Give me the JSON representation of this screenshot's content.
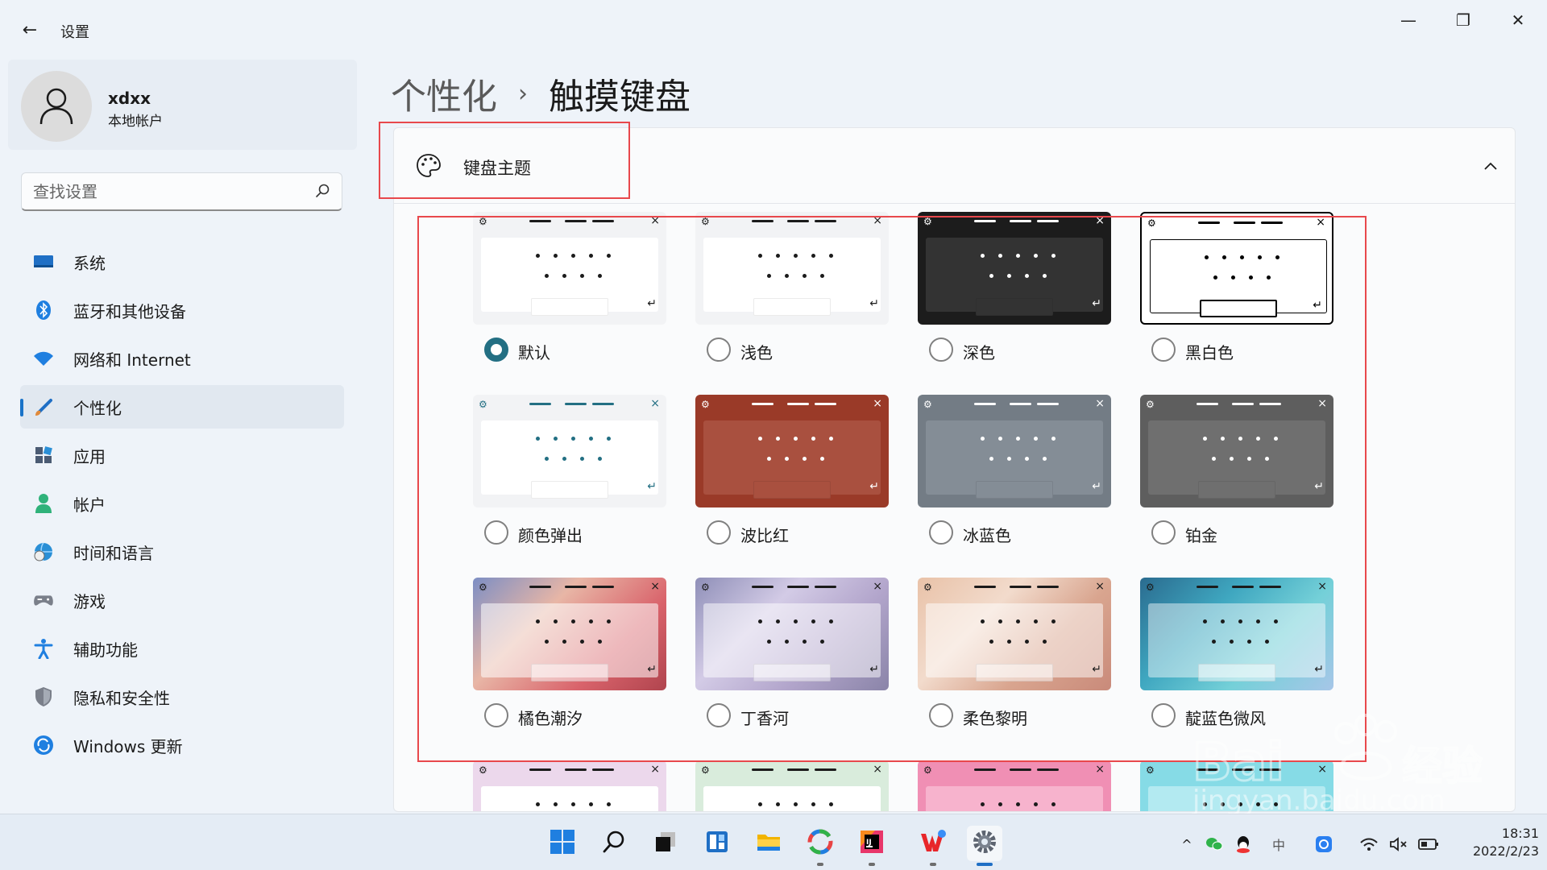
{
  "window": {
    "title": "设置",
    "back_glyph": "←",
    "min_glyph": "—",
    "max_glyph": "❐",
    "close_glyph": "✕"
  },
  "user": {
    "name": "xdxx",
    "account_type": "本地帐户"
  },
  "search": {
    "placeholder": "查找设置"
  },
  "nav": [
    {
      "label": "系统",
      "icon": "system-icon",
      "color": "#1f6fc5"
    },
    {
      "label": "蓝牙和其他设备",
      "icon": "bluetooth-icon",
      "color": "#1f7fe0"
    },
    {
      "label": "网络和 Internet",
      "icon": "wifi-icon",
      "color": "#1f7fe0"
    },
    {
      "label": "个性化",
      "icon": "brush-icon",
      "color": "#e08a3c",
      "active": true
    },
    {
      "label": "应用",
      "icon": "apps-icon",
      "color": "#4b5b73"
    },
    {
      "label": "帐户",
      "icon": "account-icon",
      "color": "#2fb27a"
    },
    {
      "label": "时间和语言",
      "icon": "globe-clock-icon",
      "color": "#2a8fd6"
    },
    {
      "label": "游戏",
      "icon": "gamepad-icon",
      "color": "#7a7f8a"
    },
    {
      "label": "辅助功能",
      "icon": "accessibility-icon",
      "color": "#1f7fe0"
    },
    {
      "label": "隐私和安全性",
      "icon": "shield-icon",
      "color": "#7a7f8a"
    },
    {
      "label": "Windows 更新",
      "icon": "update-icon",
      "color": "#1f7fe0"
    }
  ],
  "breadcrumb": {
    "parent": "个性化",
    "separator": "›",
    "current": "触摸键盘"
  },
  "keyboard_theme": {
    "title": "键盘主题",
    "selected": "默认",
    "themes": [
      {
        "label": "默认",
        "bg": "#f2f3f5",
        "panel": "#ffffff",
        "fg": "#1b1b1b",
        "space": "#ffffff",
        "selected": true
      },
      {
        "label": "浅色",
        "bg": "#f2f3f5",
        "panel": "#ffffff",
        "fg": "#1b1b1b",
        "space": "#ffffff"
      },
      {
        "label": "深色",
        "bg": "#1c1c1c",
        "panel": "#333333",
        "fg": "#ffffff",
        "space": "#333333"
      },
      {
        "label": "黑白色",
        "bg": "#ffffff",
        "panel": "#ffffff",
        "fg": "#000000",
        "space": "#ffffff",
        "outline": true
      },
      {
        "label": "颜色弹出",
        "bg": "#f2f3f5",
        "panel": "#ffffff",
        "fg": "#236f83",
        "space": "#ffffff"
      },
      {
        "label": "波比红",
        "bg": "#9a3a28",
        "panel": "#a9503f",
        "fg": "#ffffff",
        "space": "#a9503f"
      },
      {
        "label": "冰蓝色",
        "bg": "#737c85",
        "panel": "#848d96",
        "fg": "#ffffff",
        "space": "#848d96"
      },
      {
        "label": "铂金",
        "bg": "#5e5e5e",
        "panel": "#6f6f6f",
        "fg": "#ffffff",
        "space": "#6f6f6f"
      },
      {
        "label": "橘色潮汐",
        "bg": "linear-gradient(135deg,#7c8ec4 0%,#e8b6a6 35%,#d9636b 70%,#b0444e 100%)",
        "panel": "rgba(255,255,255,0.55)",
        "fg": "#1b1b1b",
        "space": "rgba(255,255,255,0.5)"
      },
      {
        "label": "丁香河",
        "bg": "linear-gradient(135deg,#8f8fb8 0%,#d3cbe6 35%,#b3a6cc 65%,#8a84a8 100%)",
        "panel": "rgba(255,255,255,0.5)",
        "fg": "#1b1b1b",
        "space": "rgba(255,255,255,0.5)"
      },
      {
        "label": "柔色黎明",
        "bg": "linear-gradient(135deg,#e9c2a8 0%,#f2dbcc 35%,#d9a58f 65%,#c98a7a 100%)",
        "panel": "rgba(255,255,255,0.5)",
        "fg": "#1b1b1b",
        "space": "rgba(255,255,255,0.5)"
      },
      {
        "label": "靛蓝色微风",
        "bg": "linear-gradient(135deg,#2a6b8f 0%,#3fa7c0 35%,#74d0d8 65%,#a7c6e8 100%)",
        "panel": "rgba(255,255,255,0.45)",
        "fg": "#1b1b1b",
        "space": "rgba(255,255,255,0.5)"
      },
      {
        "label": "",
        "bg": "#ecd8ec",
        "panel": "#ffffff",
        "fg": "#1b1b1b",
        "space": "#ffffff",
        "partial": true
      },
      {
        "label": "",
        "bg": "#d9ecdc",
        "panel": "#ffffff",
        "fg": "#1b1b1b",
        "space": "#ffffff",
        "partial": true
      },
      {
        "label": "",
        "bg": "#f08fb4",
        "panel": "#f7b3cd",
        "fg": "#1b1b1b",
        "space": "#f7b3cd",
        "partial": true
      },
      {
        "label": "",
        "bg": "#86dbe6",
        "panel": "#b3eaf1",
        "fg": "#1b1b1b",
        "space": "#b3eaf1",
        "partial": true
      }
    ]
  },
  "taskbar": {
    "apps": [
      "windows-start-icon",
      "search-icon",
      "task-view-icon",
      "widgets-icon",
      "file-explorer-icon",
      "photos-app-icon",
      "jetbrains-intellij-icon",
      "wps-office-icon",
      "settings-gear-icon"
    ],
    "tray": {
      "ime_glyph": "中",
      "clock_time": "18:31",
      "clock_date": "2022/2/23"
    }
  },
  "colors": {
    "accent": "#236f83",
    "highlight_box": "#e8484c",
    "nav_indicator": "#1a73c8"
  }
}
